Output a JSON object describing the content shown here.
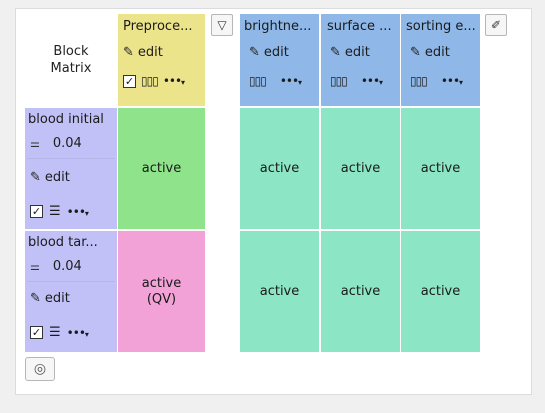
{
  "matrix": {
    "corner_label_line1": "Block",
    "corner_label_line2": "Matrix"
  },
  "columns": [
    {
      "title": "Preproce...",
      "edit_label": "edit",
      "checked": true,
      "color": "#ece48a"
    },
    {
      "title": "brightne...",
      "edit_label": "edit",
      "color": "#8fb8e8"
    },
    {
      "title": "surface ...",
      "edit_label": "edit",
      "color": "#8fb8e8"
    },
    {
      "title": "sorting e...",
      "edit_label": "edit",
      "color": "#8fb8e8"
    }
  ],
  "rows": [
    {
      "title": "blood initial",
      "value": "0.04",
      "edit_label": "edit",
      "checked": true,
      "color": "#c2c1f7"
    },
    {
      "title": "blood tar...",
      "value": "0.04",
      "edit_label": "edit",
      "checked": true,
      "color": "#c2c1f7"
    }
  ],
  "cells": [
    [
      "active",
      "active",
      "active",
      "active"
    ],
    [
      "active\n(QV)",
      "active",
      "active",
      "active"
    ]
  ],
  "cell_colors": {
    "active": "#8fe38a",
    "active_qv": "#f2a2d7",
    "teal": "#8ce6c6"
  },
  "icons": {
    "filter": "filter-icon",
    "edit": "pen-icon",
    "columns": "columns-icon",
    "more": "more-icon",
    "brush": "brush-icon",
    "add": "add-block-icon"
  },
  "glyphs": {
    "pen": "✎",
    "bars": "▯▯▯",
    "rows": "☰",
    "dots": "•••",
    "tri": "▾",
    "check": "✓",
    "filter": "▽",
    "brush": "✐",
    "level": "⚌",
    "bottom": "◎"
  }
}
